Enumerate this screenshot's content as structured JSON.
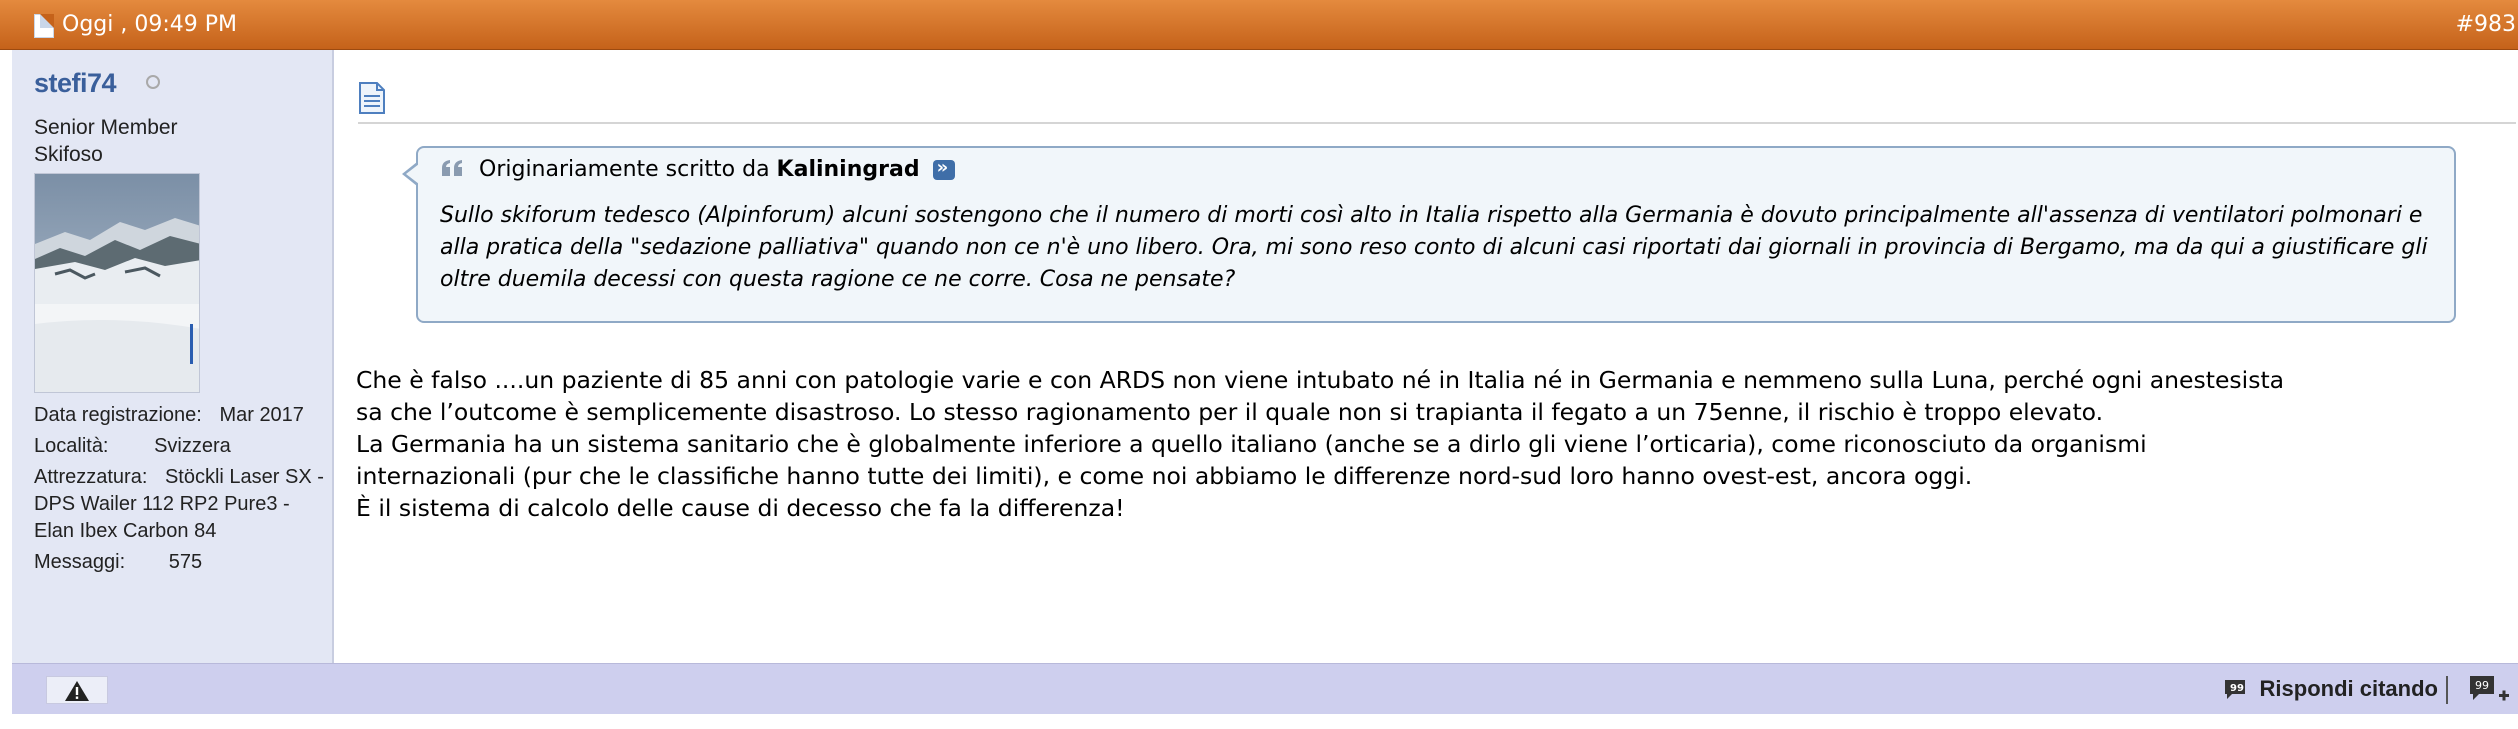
{
  "header": {
    "date": "Oggi , 09:49 PM",
    "post_number": "#983"
  },
  "user": {
    "username": "stefi74",
    "title_line1": "Senior Member",
    "title_line2": "Skifoso",
    "stats": [
      {
        "label": "Data registrazione:",
        "value": "Mar 2017"
      },
      {
        "label": "Località:",
        "value": "Svizzera"
      },
      {
        "label": "Attrezzatura:",
        "value": "Stöckli Laser SX - DPS Wailer 112 RP2 Pure3 - Elan Ibex Carbon 84"
      },
      {
        "label": "Messaggi:",
        "value": "575"
      }
    ]
  },
  "quote": {
    "prefix": "Originariamente scritto da",
    "author": "Kaliningrad",
    "text": "Sullo skiforum tedesco (Alpinforum) alcuni sostengono che il numero di morti così alto in Italia rispetto alla Germania è dovuto principalmente all'assenza di ventilatori polmonari e alla pratica della \"sedazione palliativa\" quando non ce n'è uno libero. Ora, mi sono reso conto di alcuni casi riportati dai giornali in provincia di Bergamo, ma da qui a giustificare gli oltre duemila decessi con questa ragione ce ne corre. Cosa ne pensate?"
  },
  "message": {
    "lines": [
      "Che è falso ....un paziente di 85 anni con patologie varie e con ARDS non viene intubato né in Italia né in Germania e nemmeno sulla Luna, perché ogni anestesista",
      "sa che l’outcome è semplicemente disastroso. Lo stesso ragionamento per il quale non si trapianta il fegato a un 75enne, il rischio è troppo elevato.",
      "La Germania ha un sistema sanitario che è globalmente inferiore a quello italiano (anche se a dirlo gli viene l’orticaria), come riconosciuto da organismi",
      "internazionali (pur che le classifiche hanno tutte dei limiti), e come noi abbiamo le differenze nord-sud loro hanno ovest-est, ancora oggi.",
      "È il sistema di calcolo delle cause di decesso che fa la differenza!"
    ]
  },
  "footer": {
    "reply_quote_label": "Rispondi citando"
  },
  "colors": {
    "header": "#d4722a",
    "username": "#3a5f9b",
    "sidebar": "#e3e7f4",
    "quote_bg": "#f1f6fa",
    "quote_border": "#8fa9c6",
    "footer": "#cecfee"
  }
}
